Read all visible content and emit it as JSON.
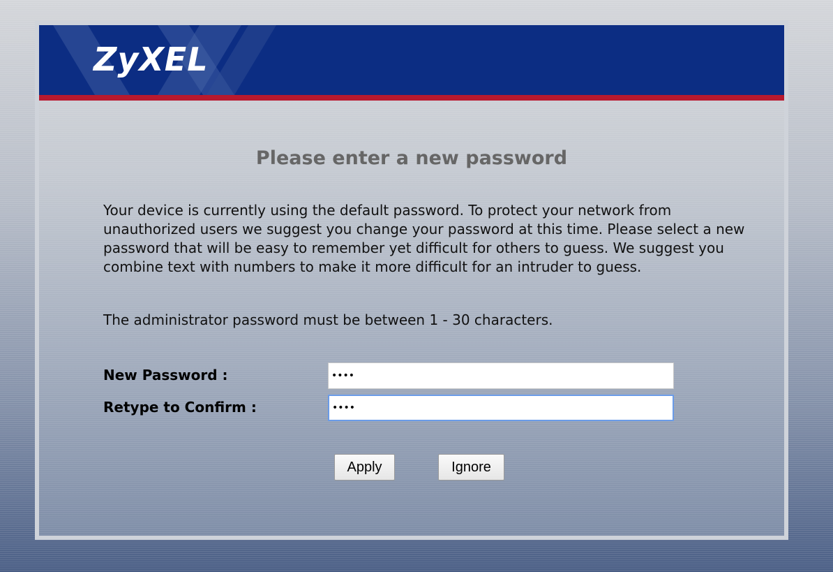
{
  "brand": {
    "logo_text": "ZyXEL",
    "banner_color": "#0c2d83",
    "stripe_color": "#b8192e"
  },
  "page": {
    "heading": "Please enter a new password",
    "intro_text": "Your device is currently using the default password. To protect your network from unauthorized users we suggest you change your password at this time. Please select a new password that will be easy to remember yet difficult for others to guess. We suggest you combine text with numbers to make it more difficult for an intruder to guess.",
    "rule_text": "The administrator password must be between 1 - 30 characters."
  },
  "form": {
    "new_password": {
      "label": "New Password :",
      "value": "1234"
    },
    "retype_password": {
      "label": "Retype to Confirm :",
      "value": "1234"
    }
  },
  "buttons": {
    "apply_label": "Apply",
    "ignore_label": "Ignore"
  }
}
